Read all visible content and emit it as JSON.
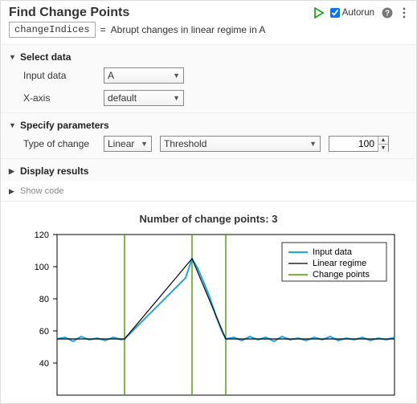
{
  "header": {
    "title": "Find Change Points",
    "autorun_label": "Autorun",
    "autorun_checked": true
  },
  "output": {
    "var_name": "changeIndices",
    "equals": "=",
    "description": "Abrupt changes in linear regime in A"
  },
  "sections": {
    "select_data": {
      "label": "Select data",
      "expanded": true,
      "fields": {
        "input_data": {
          "label": "Input data",
          "value": "A"
        },
        "x_axis": {
          "label": "X-axis",
          "value": "default"
        }
      }
    },
    "specify_params": {
      "label": "Specify parameters",
      "expanded": true,
      "fields": {
        "type_of_change": {
          "label": "Type of change",
          "value": "Linear"
        },
        "threshold": {
          "label_select": "Threshold",
          "value": "100"
        }
      }
    },
    "display_results": {
      "label": "Display results",
      "expanded": false
    },
    "show_code": {
      "label": "Show code",
      "expanded": false
    }
  },
  "plot": {
    "title": "Number of change points: 3",
    "legend": [
      "Input data",
      "Linear regime",
      "Change points"
    ],
    "y_ticks": [
      "120",
      "100",
      "80",
      "60",
      "40"
    ]
  },
  "chart_data": {
    "type": "line",
    "title": "Number of change points: 3",
    "xrange": [
      0,
      500
    ],
    "yrange": [
      20,
      120
    ],
    "series": [
      {
        "name": "Input data",
        "color": "#1ca8e6",
        "segments": [
          {
            "kind": "flat-noisy",
            "x0": 0,
            "x1": 100,
            "y": 55,
            "noise_amp": 3
          },
          {
            "kind": "ramp",
            "x0": 100,
            "x1": 200,
            "y0": 55,
            "y1": 105,
            "noise_amp": 3
          },
          {
            "kind": "ramp",
            "x0": 200,
            "x1": 250,
            "y0": 105,
            "y1": 55,
            "noise_amp": 3
          },
          {
            "kind": "flat-noisy",
            "x0": 250,
            "x1": 500,
            "y": 55,
            "noise_amp": 3
          }
        ]
      },
      {
        "name": "Linear regime",
        "color": "#000000",
        "segments": [
          {
            "kind": "line",
            "x0": 0,
            "x1": 100,
            "y0": 55,
            "y1": 55
          },
          {
            "kind": "line",
            "x0": 100,
            "x1": 200,
            "y0": 55,
            "y1": 105
          },
          {
            "kind": "line",
            "x0": 200,
            "x1": 250,
            "y0": 105,
            "y1": 55
          },
          {
            "kind": "line",
            "x0": 250,
            "x1": 500,
            "y0": 55,
            "y1": 55
          }
        ]
      },
      {
        "name": "Change points",
        "color": "#4a9b00",
        "x_positions": [
          100,
          200,
          250
        ]
      }
    ]
  }
}
